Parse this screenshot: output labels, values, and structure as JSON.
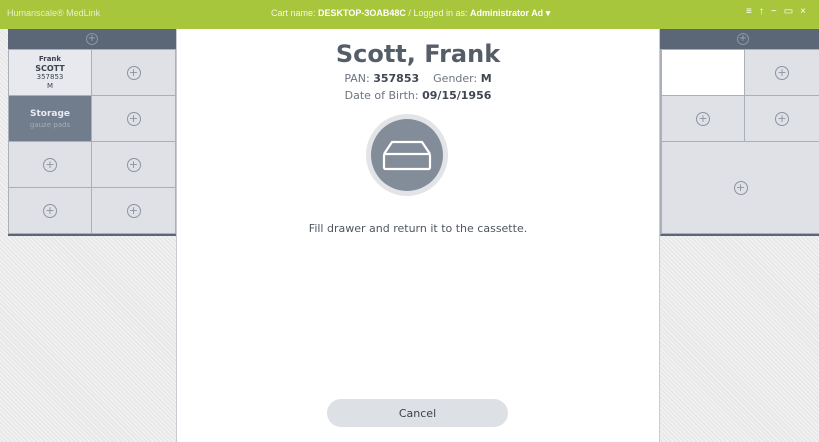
{
  "titlebar": {
    "app_name": "Humanscale® MedLink",
    "cart_label": "Cart name:",
    "cart_name": "DESKTOP-3OAB48C",
    "separator": "/",
    "logged_label": "Logged in as:",
    "user": "Administrator Ad",
    "user_caret": "▾",
    "menu_icon": "≡",
    "info_icon": "↑",
    "minimize_icon": "−",
    "maximize_icon": "▭",
    "close_icon": "×"
  },
  "left_panel": {
    "header_add": "+",
    "patient": {
      "first": "Frank",
      "last": "SCOTT",
      "id": "357853",
      "gender": "M"
    },
    "storage": {
      "title": "Storage",
      "detail": "gauze pads"
    },
    "add_symbol": "+"
  },
  "patient_detail": {
    "name": "Scott, Frank",
    "pan_label": "PAN:",
    "pan": "357853",
    "gender_label": "Gender:",
    "gender": "M",
    "dob_label": "Date of Birth:",
    "dob": "09/15/1956",
    "icon": "drawer-icon",
    "instruction": "Fill drawer and return it to the cassette.",
    "cancel_label": "Cancel"
  },
  "right_panel": {
    "header_add": "+",
    "add_symbol": "+"
  },
  "colors": {
    "titlebar": "#a8c63c",
    "panel_header": "#5b6677",
    "cell": "#dfe1e6",
    "storage_cell": "#717c8d",
    "icon_circle": "#838c99"
  }
}
